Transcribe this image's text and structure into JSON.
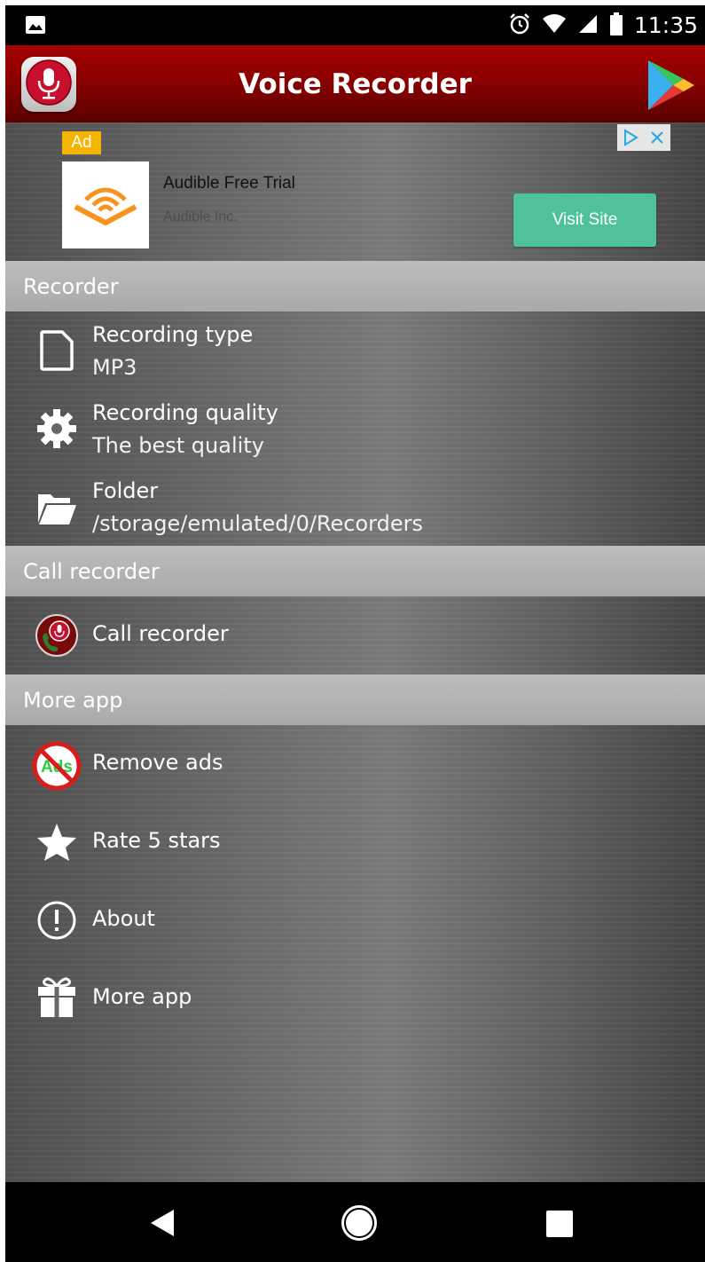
{
  "status_bar": {
    "time": "11:35"
  },
  "app_bar": {
    "title": "Voice Recorder"
  },
  "ad": {
    "badge": "Ad",
    "title": "Audible Free Trial",
    "advertiser": "Audible Inc.",
    "cta": "Visit Site"
  },
  "sections": {
    "recorder": {
      "header": "Recorder",
      "recording_type": {
        "label": "Recording type",
        "value": "MP3"
      },
      "recording_quality": {
        "label": "Recording quality",
        "value": "The best quality"
      },
      "folder": {
        "label": "Folder",
        "value": "/storage/emulated/0/Recorders"
      }
    },
    "call_recorder": {
      "header": "Call recorder",
      "item": {
        "label": "Call recorder"
      }
    },
    "more_app": {
      "header": "More app",
      "remove_ads": {
        "label": "Remove ads",
        "icon_text": "Ads"
      },
      "rate": {
        "label": "Rate 5 stars"
      },
      "about": {
        "label": "About"
      },
      "more": {
        "label": "More app"
      }
    }
  },
  "colors": {
    "app_bar": "#8c0000",
    "ad_badge": "#f5b400",
    "visit_button": "#4fc19b",
    "section_header": "#b3b3b3"
  },
  "icons": {
    "status_left": "image-icon",
    "status_right": [
      "alarm-icon",
      "wifi-icon",
      "cell-signal-icon",
      "battery-icon"
    ],
    "app_logo": "microphone-icon",
    "play_store": "play-store-icon",
    "rows": [
      "file-icon",
      "gear-icon",
      "folder-icon",
      "call-recorder-icon",
      "no-ads-icon",
      "star-icon",
      "info-icon",
      "gift-icon"
    ],
    "nav": [
      "back-icon",
      "home-icon",
      "recents-icon"
    ]
  }
}
